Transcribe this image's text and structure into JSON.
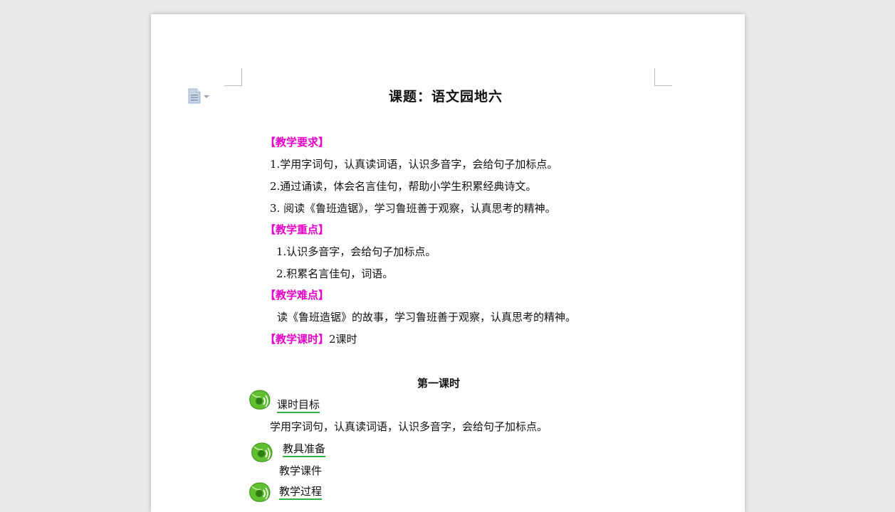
{
  "document": {
    "title": "课题：语文园地六",
    "requirements_heading": "【教学要求】",
    "requirements": [
      "1.学用字词句，认真读词语，认识多音字，会给句子加标点。",
      "2.通过诵读，体会名言佳句，帮助小学生积累经典诗文。",
      "3. 阅读《鲁班造锯》，学习鲁班善于观察，认真思考的精神。"
    ],
    "key_points_heading": "【教学重点】",
    "key_points": [
      "1.认识多音字，会给句子加标点。",
      "2.积累名言佳句，词语。"
    ],
    "difficulties_heading": "【教学难点】",
    "difficulty_text": "读《鲁班造锯》的故事，学习鲁班善于观察，认真思考的精神。",
    "hours_heading": "【教学课时】",
    "hours_value": "2课时",
    "lesson_heading": "第一课时",
    "sections": [
      {
        "title": "课时目标",
        "body": "学用字词句，认真读词语，认识多音字，会给句子加标点。"
      },
      {
        "title": "教具准备",
        "body": "教学课件"
      },
      {
        "title": "教学过程",
        "body": ""
      }
    ]
  },
  "icons": {
    "page_doc": "document-icon",
    "section": "green-sound-leaf-icon"
  },
  "colors": {
    "heading_magenta": "#e600c8",
    "underline_green": "#33b24a"
  }
}
